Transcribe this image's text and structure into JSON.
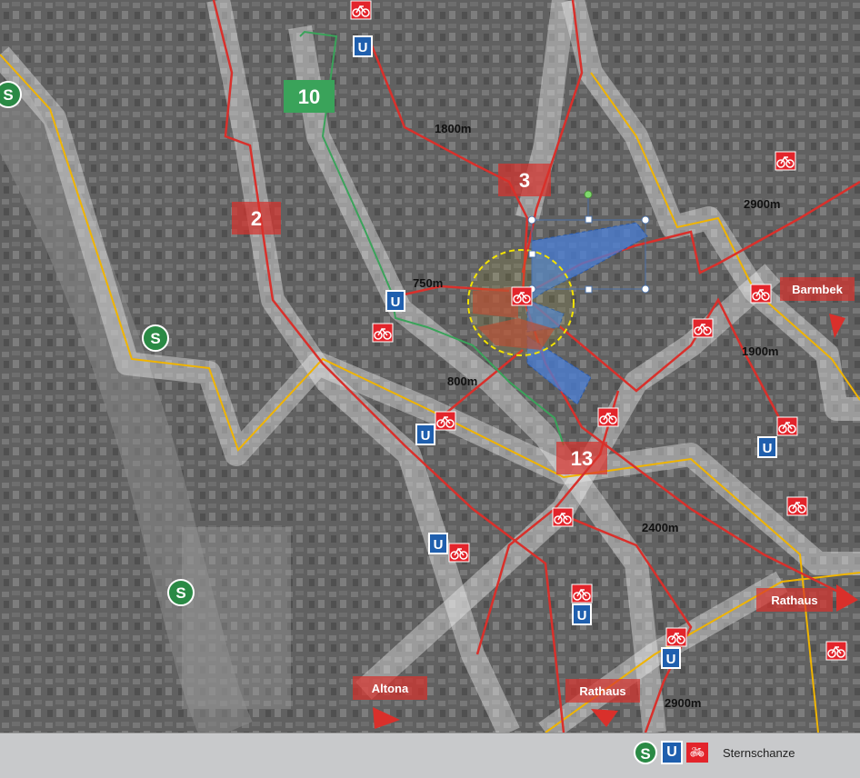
{
  "map": {
    "distances": {
      "d1800": "1800m",
      "d750": "750m",
      "d800": "800m",
      "d2900_top": "2900m",
      "d1900": "1900m",
      "d2400": "2400m",
      "d2900_bottom": "2900m"
    },
    "route_numbers": {
      "r10": "10",
      "r2": "2",
      "r3": "3",
      "r13": "13"
    },
    "destinations": {
      "barmbek": "Barmbek",
      "rathaus_right": "Rathaus",
      "rathaus_bottom": "Rathaus",
      "altona": "Altona"
    },
    "icons": {
      "s_bahn": "S",
      "u_bahn": "U",
      "bike": "bike-icon"
    }
  },
  "legend": {
    "s_symbol": "S",
    "u_symbol": "U",
    "station_name": "Sternschanze"
  },
  "colors": {
    "corridor_red": "#d9302b",
    "corridor_yellow": "#f0b400",
    "corridor_green": "#3aa35a",
    "s_bahn_green": "#2a8a45",
    "u_bahn_blue": "#1f5fae",
    "bike_red": "#e3242b",
    "district_blue": "#4a7fd8",
    "district_red": "#b5453a",
    "catchment_yellow": "#f4e300"
  }
}
